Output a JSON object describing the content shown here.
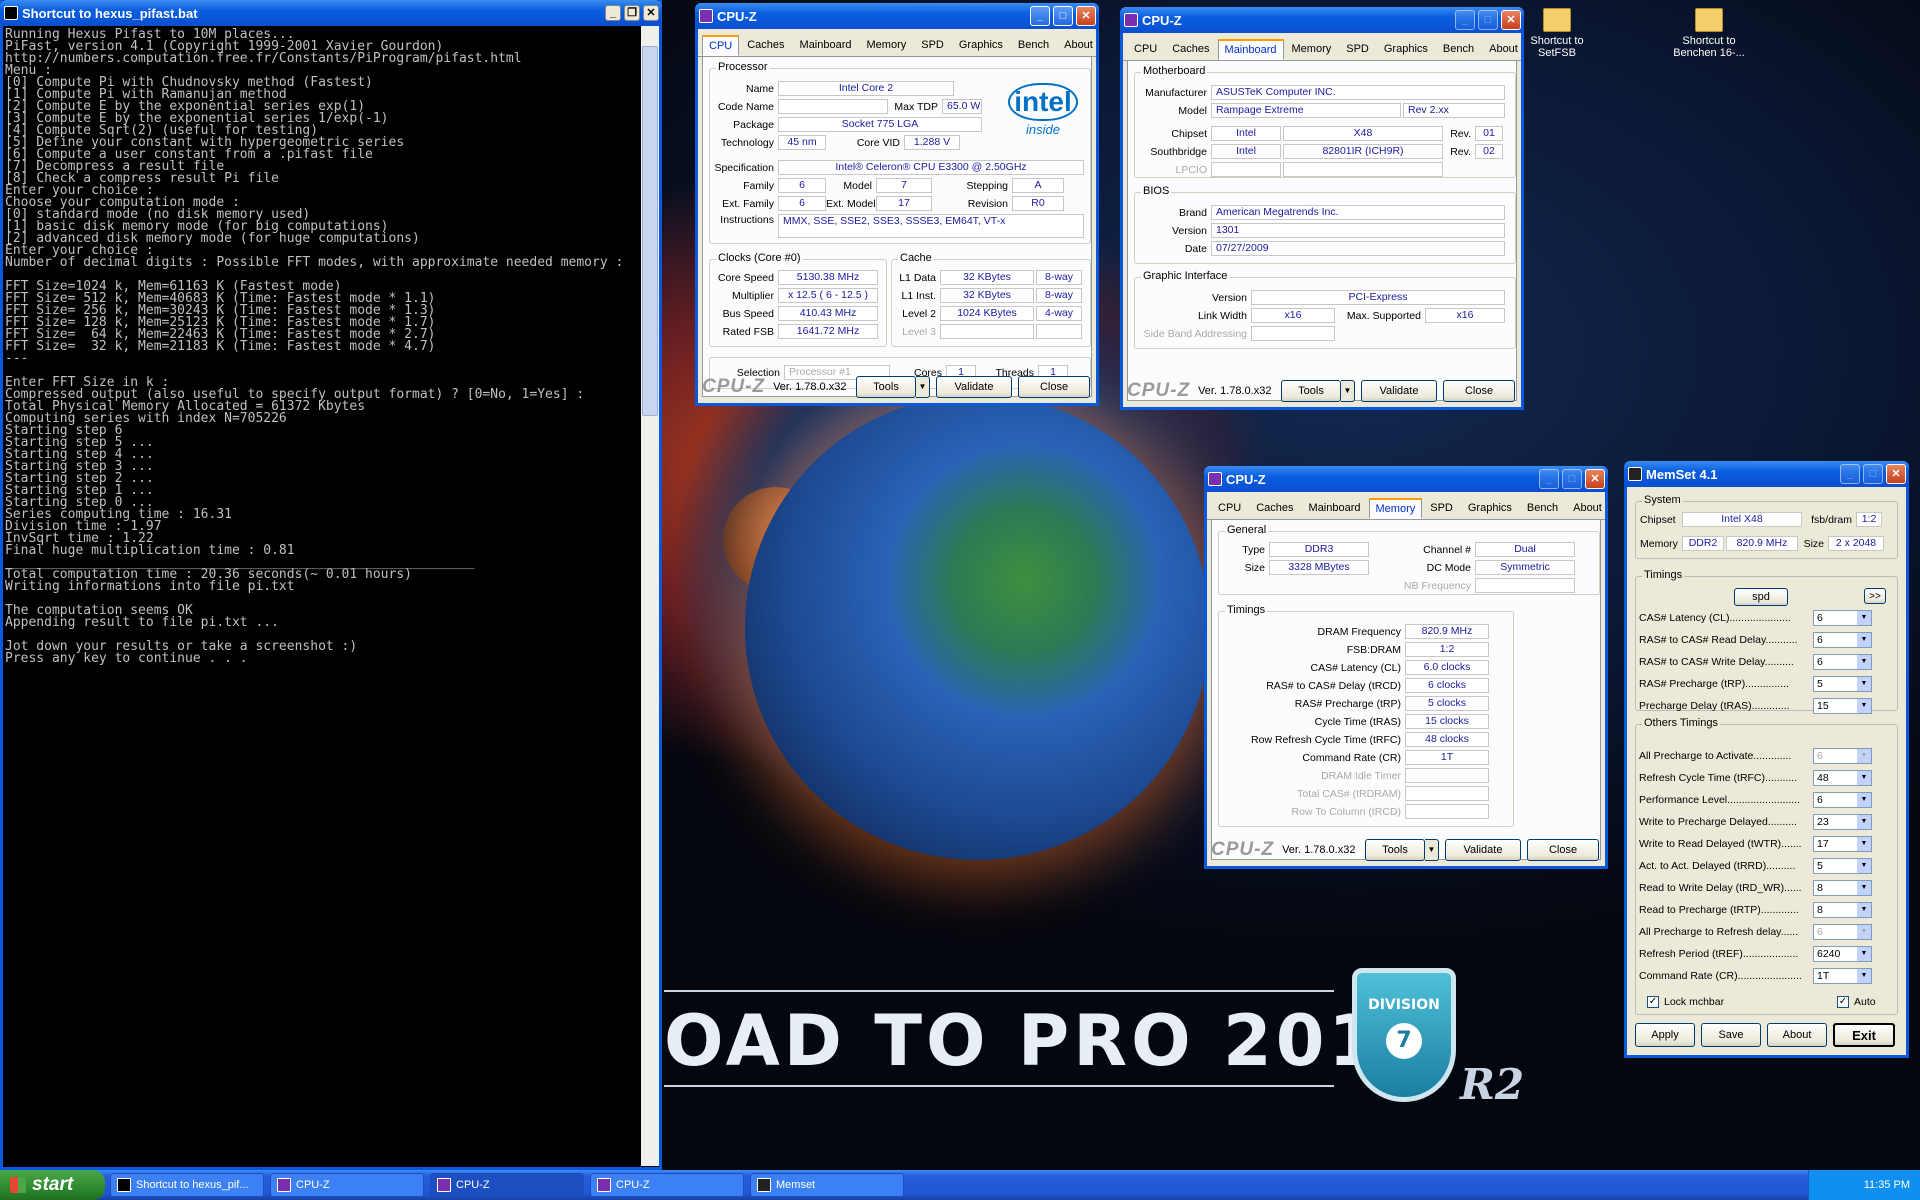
{
  "console": {
    "title": "Shortcut to hexus_pifast.bat",
    "text": "Running Hexus Pifast to 10M places...\nPiFast, version 4.1 (Copyright 1999-2001 Xavier Gourdon)\nhttp://numbers.computation.free.fr/Constants/PiProgram/pifast.html\nMenu :\n[0] Compute Pi with Chudnovsky method (Fastest)\n[1] Compute Pi with Ramanujan method\n[2] Compute E by the exponential series exp(1)\n[3] Compute E by the exponential series 1/exp(-1)\n[4] Compute Sqrt(2) (useful for testing)\n[5] Define your constant with hypergeometric series\n[6] Compute a user constant from a .pifast file\n[7] Decompress a result file\n[8] Check a compress result Pi file\nEnter your choice :\nChoose your computation mode :\n[0] standard mode (no disk memory used)\n[1] basic disk memory mode (for big computations)\n[2] advanced disk memory mode (for huge computations)\nEnter your choice :\nNumber of decimal digits : Possible FFT modes, with approximate needed memory :\n\nFFT Size=1024 k, Mem=61163 K (Fastest mode)\nFFT Size= 512 k, Mem=40683 K (Time: Fastest mode * 1.1)\nFFT Size= 256 k, Mem=30243 K (Time: Fastest mode * 1.3)\nFFT Size= 128 k, Mem=25123 K (Time: Fastest mode * 1.7)\nFFT Size=  64 k, Mem=22463 K (Time: Fastest mode * 2.7)\nFFT Size=  32 k, Mem=21183 K (Time: Fastest mode * 4.7)\n---\n\nEnter FFT Size in k :\nCompressed output (also useful to specify output format) ? [0=No, 1=Yes] :\nTotal Physical Memory Allocated = 61372 Kbytes\nComputing series with index N=705226\nStarting step 6\nStarting step 5 ...\nStarting step 4 ...\nStarting step 3 ...\nStarting step 2 ...\nStarting step 1 ...\nStarting step 0 ...\nSeries computing time : 16.31\nDivision time : 1.97\nInvSqrt time : 1.22\nFinal huge multiplication time : 0.81\n____________________________________________________________\nTotal computation time : 20.36 seconds(~ 0.01 hours)\nWriting informations into file pi.txt\n\nThe computation seems OK\nAppending result to file pi.txt ...\n\nJot down your results or take a screenshot :)\nPress any key to continue . . ."
  },
  "desktop": {
    "icons": [
      "Shortcut to SetFSB",
      "Shortcut to Benchen 16-..."
    ],
    "banner": "OAD TO PRO 2017",
    "shield_text": "DIVISION",
    "shield_num": "7",
    "r2": "R2"
  },
  "cpuz": {
    "title": "CPU-Z",
    "tabs": [
      "CPU",
      "Caches",
      "Mainboard",
      "Memory",
      "SPD",
      "Graphics",
      "Bench",
      "About"
    ],
    "version": "Ver. 1.78.0.x32",
    "logo": "CPU-Z",
    "tools": "Tools",
    "validate": "Validate",
    "close": "Close"
  },
  "cpu": {
    "proc_group": "Processor",
    "name_l": "Name",
    "name": "Intel Core 2",
    "code_l": "Code Name",
    "code": "",
    "tdp_l": "Max TDP",
    "tdp": "65.0 W",
    "pkg_l": "Package",
    "pkg": "Socket 775 LGA",
    "tech_l": "Technology",
    "tech": "45 nm",
    "vid_l": "Core VID",
    "vid": "1.288 V",
    "spec_l": "Specification",
    "spec": "Intel® Celeron® CPU      E3300  @ 2.50GHz",
    "fam_l": "Family",
    "fam": "6",
    "model_l": "Model",
    "model": "7",
    "step_l": "Stepping",
    "step": "A",
    "efam_l": "Ext. Family",
    "efam": "6",
    "emodel_l": "Ext. Model",
    "emodel": "17",
    "rev_l": "Revision",
    "rev": "R0",
    "instr_l": "Instructions",
    "instr": "MMX, SSE, SSE2, SSE3, SSSE3, EM64T, VT-x",
    "intel": "intel",
    "inside": "inside",
    "clocks_group": "Clocks (Core #0)",
    "cs_l": "Core Speed",
    "cs": "5130.38 MHz",
    "mult_l": "Multiplier",
    "mult": "x 12.5 ( 6 - 12.5 )",
    "bus_l": "Bus Speed",
    "bus": "410.43 MHz",
    "fsb_l": "Rated FSB",
    "fsb": "1641.72 MHz",
    "cache_group": "Cache",
    "l1d_l": "L1 Data",
    "l1d": "32 KBytes",
    "l1d_w": "8-way",
    "l1i_l": "L1 Inst.",
    "l1i": "32 KBytes",
    "l1i_w": "8-way",
    "l2_l": "Level 2",
    "l2": "1024 KBytes",
    "l2_w": "4-way",
    "l3_l": "Level 3",
    "sel_l": "Selection",
    "sel": "Processor #1",
    "cores_l": "Cores",
    "cores": "1",
    "threads_l": "Threads",
    "threads": "1"
  },
  "mb": {
    "mb_group": "Motherboard",
    "man_l": "Manufacturer",
    "man": "ASUSTeK Computer INC.",
    "model_l": "Model",
    "model": "Rampage Extreme",
    "rev": "Rev 2.xx",
    "chip_l": "Chipset",
    "chip_v": "Intel",
    "chip": "X48",
    "chip_rl": "Rev.",
    "chip_r": "01",
    "sb_l": "Southbridge",
    "sb_v": "Intel",
    "sb": "82801IR (ICH9R)",
    "sb_rl": "Rev.",
    "sb_r": "02",
    "lpcio_l": "LPCIO",
    "bios_group": "BIOS",
    "brand_l": "Brand",
    "brand": "American Megatrends Inc.",
    "ver_l": "Version",
    "ver": "1301",
    "date_l": "Date",
    "date": "07/27/2009",
    "gi_group": "Graphic Interface",
    "giv_l": "Version",
    "giv": "PCI-Express",
    "lw_l": "Link Width",
    "lw": "x16",
    "ms_l": "Max. Supported",
    "ms": "x16",
    "sba_l": "Side Band Addressing"
  },
  "mem": {
    "gen_group": "General",
    "type_l": "Type",
    "type": "DDR3",
    "chan_l": "Channel #",
    "chan": "Dual",
    "size_l": "Size",
    "size": "3328 MBytes",
    "dc_l": "DC Mode",
    "dc": "Symmetric",
    "nb_l": "NB Frequency",
    "tim_group": "Timings",
    "rows": [
      [
        "DRAM Frequency",
        "820.9 MHz"
      ],
      [
        "FSB:DRAM",
        "1:2"
      ],
      [
        "CAS# Latency (CL)",
        "6.0 clocks"
      ],
      [
        "RAS# to CAS# Delay (tRCD)",
        "6 clocks"
      ],
      [
        "RAS# Precharge (tRP)",
        "5 clocks"
      ],
      [
        "Cycle Time (tRAS)",
        "15 clocks"
      ],
      [
        "Row Refresh Cycle Time (tRFC)",
        "48 clocks"
      ],
      [
        "Command Rate (CR)",
        "1T"
      ],
      [
        "DRAM Idle Timer",
        ""
      ],
      [
        "Total CAS# (tRDRAM)",
        ""
      ],
      [
        "Row To Column (tRCD)",
        ""
      ]
    ]
  },
  "memset": {
    "title": "MemSet 4.1",
    "sys_group": "System",
    "chip_l": "Chipset",
    "chip": "Intel  X48",
    "fsb_l": "fsb/dram",
    "fsb": "1:2",
    "mem_l": "Memory",
    "mem_t": "DDR2",
    "mem_f": "820.9 MHz",
    "size_l": "Size",
    "size": "2 x 2048",
    "tim_group": "Timings",
    "spd": "spd",
    "more": ">>",
    "timings": [
      [
        "CAS# Latency (CL).....................",
        "6"
      ],
      [
        "RAS# to CAS# Read Delay...........",
        "6"
      ],
      [
        "RAS# to CAS# Write Delay..........",
        "6"
      ],
      [
        "RAS# Precharge (tRP)...............",
        "5"
      ],
      [
        "Precharge Delay  (tRAS).............",
        "15"
      ]
    ],
    "oth_group": "Others Timings",
    "others": [
      [
        "All Precharge to Activate.............",
        "6"
      ],
      [
        "Refresh Cycle Time (tRFC)...........",
        "48"
      ],
      [
        "Performance Level.........................",
        "6"
      ],
      [
        "Write to Precharge Delayed..........",
        "23"
      ],
      [
        "Write to Read Delayed (tWTR).......",
        "17"
      ],
      [
        "Act. to Act. Delayed (tRRD)..........",
        "5"
      ],
      [
        "Read to Write Delay (tRD_WR)......",
        "8"
      ],
      [
        "Read to Precharge (tRTP).............",
        "8"
      ],
      [
        "All Precharge to Refresh delay......",
        "6"
      ],
      [
        "Refresh Period (tREF)...................",
        "6240"
      ],
      [
        "Command Rate (CR)......................",
        "1T"
      ]
    ],
    "lock": "Lock mchbar",
    "auto": "Auto",
    "apply": "Apply",
    "save": "Save",
    "about": "About",
    "exit": "Exit"
  },
  "taskbar": {
    "start": "start",
    "tasks": [
      "Shortcut to hexus_pif...",
      "CPU-Z",
      "CPU-Z",
      "CPU-Z",
      "Memset"
    ],
    "clock": "11:35 PM"
  },
  "colors": {
    "titlebar": "#0a5ee0",
    "value_text": "#1a1aa0",
    "desktop": "#0a1530"
  }
}
